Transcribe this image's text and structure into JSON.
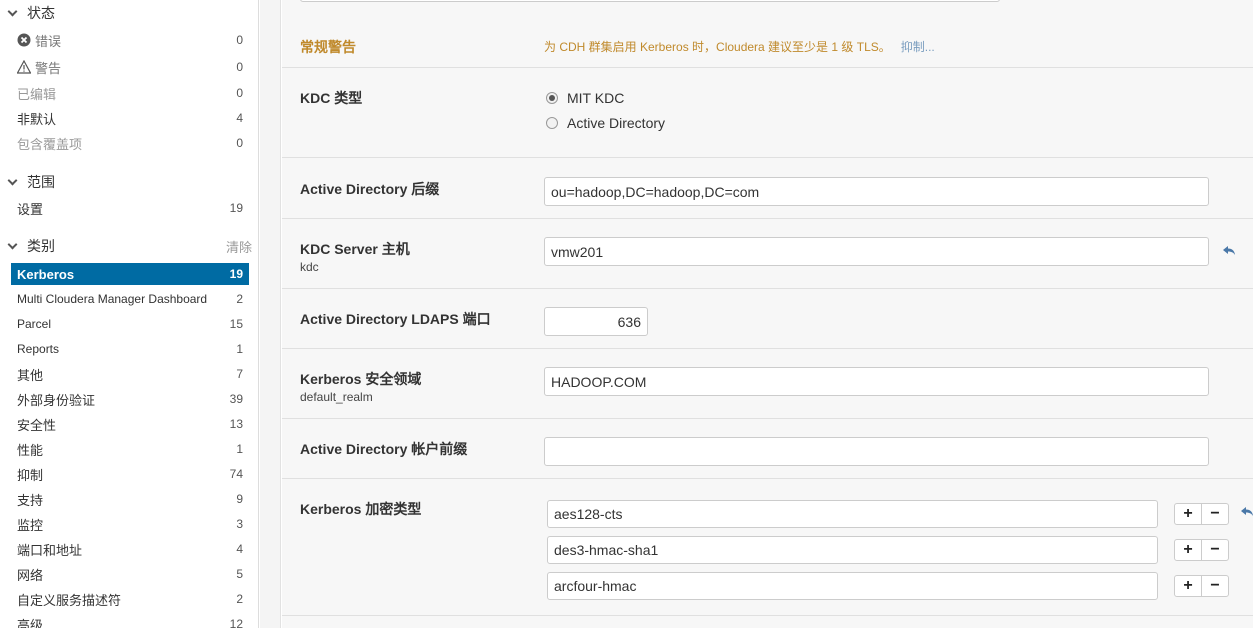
{
  "sidebar": {
    "status": {
      "title": "状态",
      "items": [
        {
          "label": "错误",
          "count": "0",
          "icon": "error-icon"
        },
        {
          "label": "警告",
          "count": "0",
          "icon": "warning-icon"
        },
        {
          "label": "已编辑",
          "count": "0"
        },
        {
          "label": "非默认",
          "count": "4"
        },
        {
          "label": "包含覆盖项",
          "count": "0"
        }
      ]
    },
    "scope": {
      "title": "范围",
      "items": [
        {
          "label": "设置",
          "count": "19"
        }
      ]
    },
    "category": {
      "title": "类别",
      "clear_label": "清除",
      "items": [
        {
          "label": "Kerberos",
          "count": "19"
        },
        {
          "label": "Multi Cloudera Manager Dashboard",
          "count": "2"
        },
        {
          "label": "Parcel",
          "count": "15"
        },
        {
          "label": "Reports",
          "count": "1"
        },
        {
          "label": "其他",
          "count": "7"
        },
        {
          "label": "外部身份验证",
          "count": "39"
        },
        {
          "label": "安全性",
          "count": "13"
        },
        {
          "label": "性能",
          "count": "1"
        },
        {
          "label": "抑制",
          "count": "74"
        },
        {
          "label": "支持",
          "count": "9"
        },
        {
          "label": "监控",
          "count": "3"
        },
        {
          "label": "端口和地址",
          "count": "4"
        },
        {
          "label": "网络",
          "count": "5"
        },
        {
          "label": "自定义服务描述符",
          "count": "2"
        },
        {
          "label": "高级",
          "count": "12"
        }
      ]
    }
  },
  "main": {
    "warning": {
      "title": "常规警告",
      "text": "为 CDH 群集启用 Kerberos 时，Cloudera 建议至少是 1 级 TLS。",
      "link": "抑制..."
    },
    "kdc_type": {
      "label": "KDC 类型",
      "options": [
        "MIT KDC",
        "Active Directory"
      ]
    },
    "ad_suffix": {
      "label": "Active Directory 后缀",
      "value": "ou=hadoop,DC=hadoop,DC=com"
    },
    "kdc_server": {
      "label": "KDC Server 主机",
      "sub": "kdc",
      "value": "vmw201"
    },
    "ldaps_port": {
      "label": "Active Directory LDAPS 端口",
      "value": "636"
    },
    "realm": {
      "label": "Kerberos 安全领域",
      "sub": "default_realm",
      "value": "HADOOP.COM"
    },
    "account_prefix": {
      "label": "Active Directory 帐户前缀",
      "value": ""
    },
    "enc_types": {
      "label": "Kerberos 加密类型",
      "values": [
        "aes128-cts",
        "des3-hmac-sha1",
        "arcfour-hmac"
      ],
      "plus": "+",
      "minus": "−"
    }
  },
  "colors": {
    "accent": "#006ba3",
    "warning": "#c08a2c",
    "link": "#7a9dbf"
  }
}
